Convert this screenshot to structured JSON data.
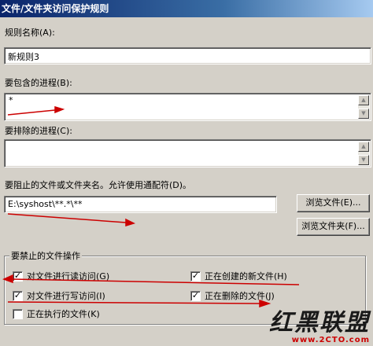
{
  "window": {
    "title": "文件/文件夹访问保护规则"
  },
  "rule_name": {
    "label": "规则名称(A):",
    "value": "新规则3"
  },
  "include_processes": {
    "label": "要包含的进程(B):",
    "value": "*"
  },
  "exclude_processes": {
    "label": "要排除的进程(C):",
    "value": ""
  },
  "blocked_path": {
    "label": "要阻止的文件或文件夹名。允许使用通配符(D)。",
    "value": "E:\\syshost\\**.*\\**"
  },
  "buttons": {
    "browse_file": "浏览文件(E)...",
    "browse_folder": "浏览文件夹(F)..."
  },
  "operations": {
    "title": "要禁止的文件操作",
    "items": [
      {
        "label": "对文件进行读访问(G)",
        "checked": true
      },
      {
        "label": "正在创建的新文件(H)",
        "checked": true
      },
      {
        "label": "对文件进行写访问(I)",
        "checked": true
      },
      {
        "label": "正在删除的文件(J)",
        "checked": true
      },
      {
        "label": "正在执行的文件(K)",
        "checked": false
      }
    ]
  },
  "icons": {
    "scroll_up": "up-arrow-icon",
    "scroll_down": "down-arrow-icon",
    "check": "checkmark-icon"
  },
  "watermark": {
    "brand": "红黑联盟",
    "url": "www.2CTO.com"
  },
  "colors": {
    "dialog_bg": "#d4d0c8",
    "title_bar": "#0a246a",
    "annotation_red": "#cc0000"
  }
}
